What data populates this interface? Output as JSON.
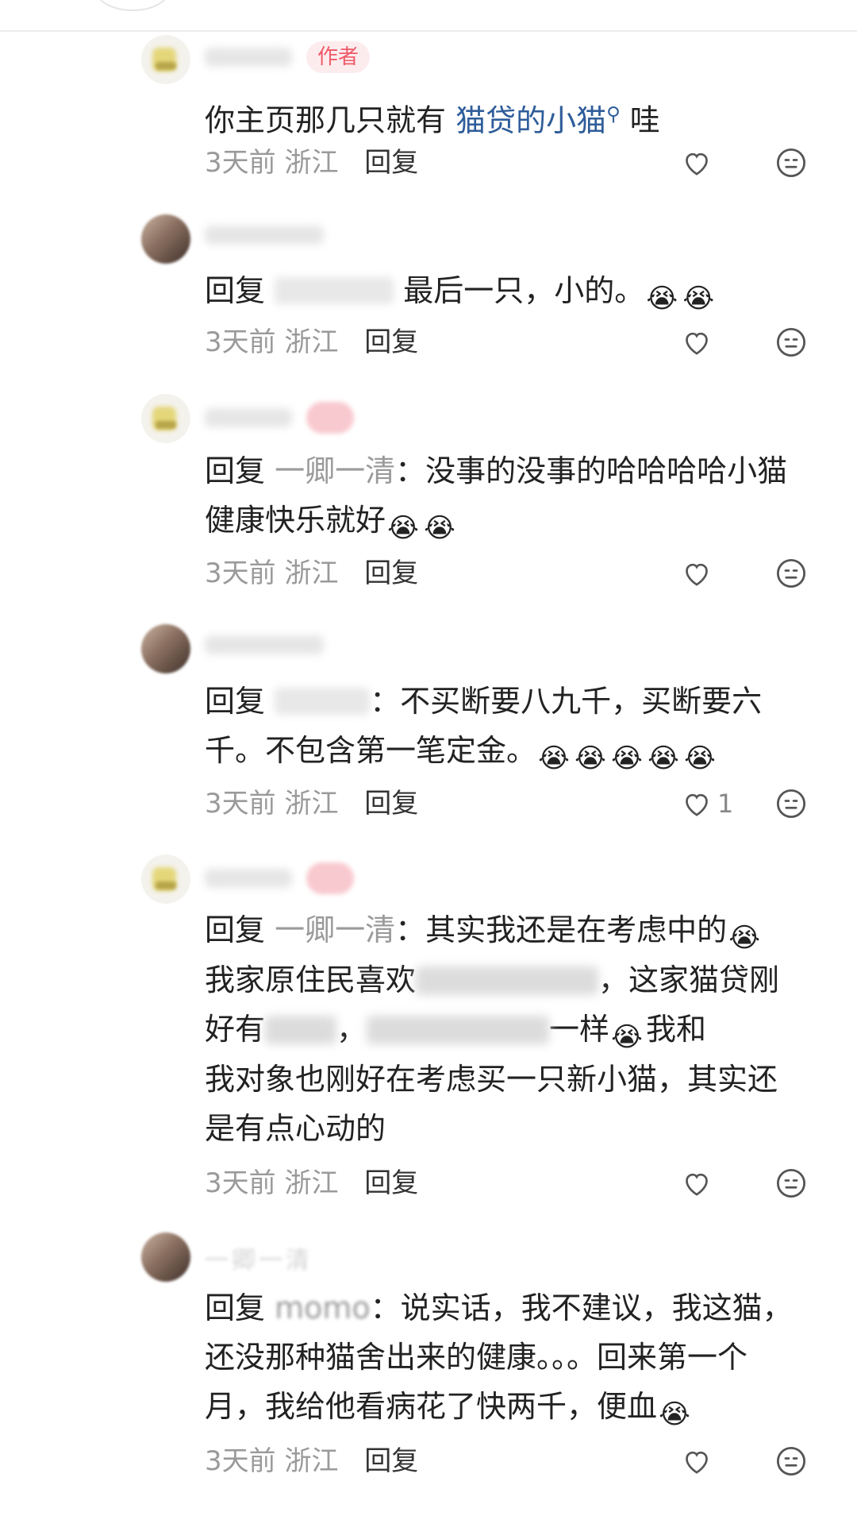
{
  "comments": [
    {
      "is_author": true,
      "author_badge": "作者",
      "text": "你主页那几只就有",
      "link_text": "猫贷的小猫",
      "link_icon": "search-icon",
      "text_tail": "哇",
      "time": "3天前",
      "location": "浙江",
      "reply_label": "回复",
      "like_count": ""
    },
    {
      "reply_prefix": "回复",
      "line1": "最后一只，小的。",
      "emoji": "crying-face",
      "emoji_count": 2,
      "time": "3天前",
      "location": "浙江",
      "reply_label": "回复",
      "like_count": ""
    },
    {
      "is_author": true,
      "reply_prefix": "回复",
      "reply_target": "一卿一清",
      "line1": "：没事的没事的哈哈哈哈小猫",
      "line2": "健康快乐就好",
      "emoji": "crying-face",
      "emoji_count": 2,
      "time": "3天前",
      "location": "浙江",
      "reply_label": "回复",
      "like_count": ""
    },
    {
      "reply_prefix": "回复",
      "line1": "：不买断要八九千，买断要六",
      "line2": "千。不包含第一笔定金。",
      "emoji": "crying-face",
      "emoji_count": 5,
      "time": "3天前",
      "location": "浙江",
      "reply_label": "回复",
      "like_count": "1"
    },
    {
      "is_author": true,
      "reply_prefix": "回复",
      "reply_target": "一卿一清",
      "line1": "：其实我还是在考虑中的",
      "line2_start": "我家原住民喜欢",
      "line2_end": "，这家猫贷刚",
      "line3_start": "好有",
      "line3_mid": "，",
      "line3_end": "一样",
      "line3_tail": "我和",
      "line4": "我对象也刚好在考虑买一只新小猫，其实还",
      "line5": "是有点心动的",
      "emoji": "crying-face",
      "time": "3天前",
      "location": "浙江",
      "reply_label": "回复",
      "like_count": ""
    },
    {
      "name_partial": "一卿一清",
      "reply_prefix": "回复",
      "reply_target": "momo",
      "line1": "：说实话，我不建议，我这猫，",
      "line2": "还没那种猫舍出来的健康。。。回来第一个",
      "line3": "月，我给他看病花了快两千，便血",
      "emoji": "crying-face",
      "time": "3天前",
      "location": "浙江",
      "reply_label": "回复",
      "like_count": ""
    }
  ],
  "colors": {
    "link": "#2f5d9a",
    "meta": "#9a9a9a",
    "author_badge_bg": "#fdecee",
    "author_badge_text": "#ef5a68"
  }
}
